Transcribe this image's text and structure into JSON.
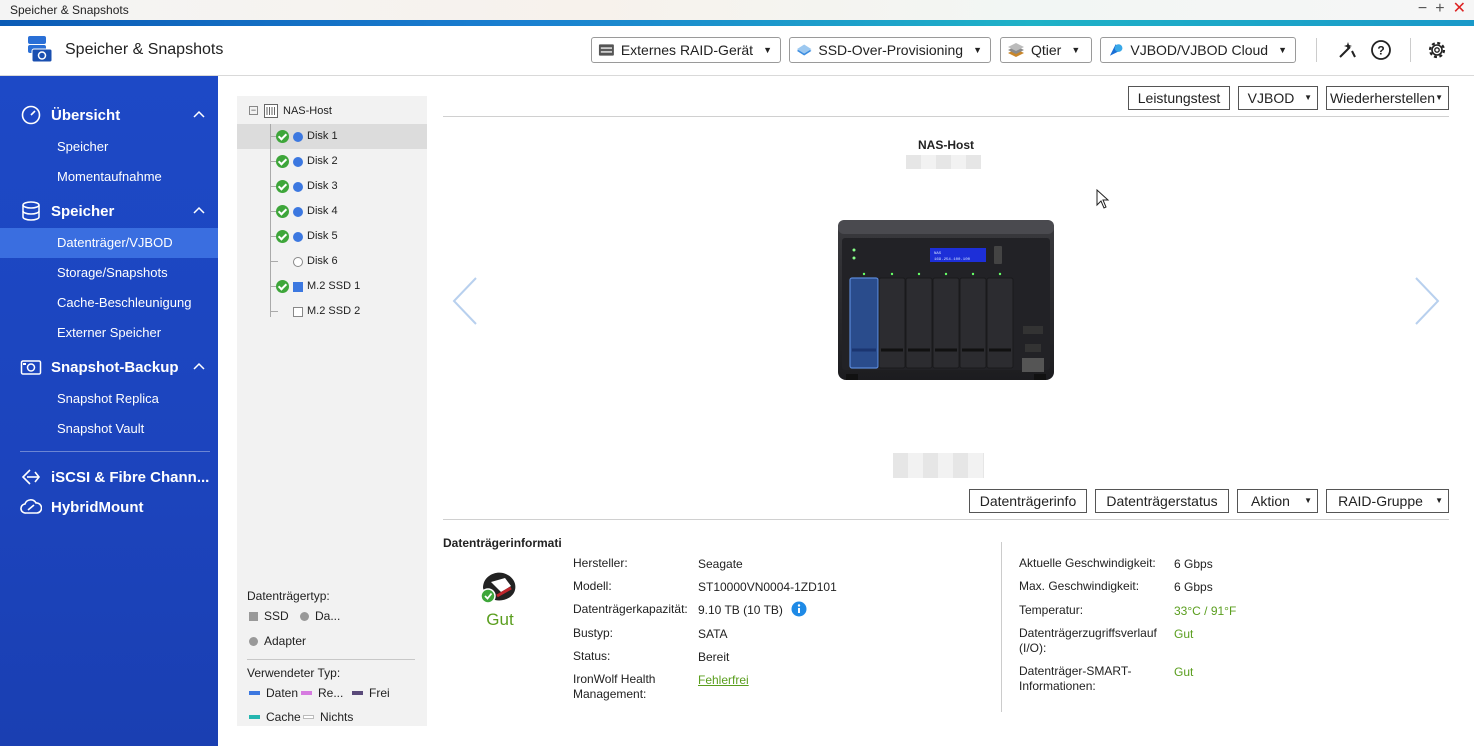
{
  "window": {
    "title": "Speicher & Snapshots"
  },
  "header": {
    "app_title": "Speicher & Snapshots",
    "buttons": [
      {
        "label": "Externes RAID-Gerät",
        "icon": "raid-device-icon"
      },
      {
        "label": "SSD-Over-Provisioning",
        "icon": "ssd-icon"
      },
      {
        "label": "Qtier",
        "icon": "qtier-icon"
      },
      {
        "label": "VJBOD/VJBOD Cloud",
        "icon": "vjbod-cloud-icon"
      }
    ],
    "icons": [
      "tools-icon",
      "help-icon",
      "settings-icon"
    ]
  },
  "sidebar": {
    "groups": [
      {
        "label": "Übersicht",
        "icon": "dashboard-icon",
        "items": [
          "Speicher",
          "Momentaufnahme"
        ]
      },
      {
        "label": "Speicher",
        "icon": "storage-icon",
        "items": [
          "Datenträger/VJBOD",
          "Storage/Snapshots",
          "Cache-Beschleunigung",
          "Externer Speicher"
        ]
      },
      {
        "label": "Snapshot-Backup",
        "icon": "snapshot-backup-icon",
        "items": [
          "Snapshot Replica",
          "Snapshot Vault"
        ]
      }
    ],
    "extra": [
      {
        "label": "iSCSI & Fibre Chann...",
        "icon": "iscsi-icon"
      },
      {
        "label": "HybridMount",
        "icon": "cloud-icon"
      }
    ]
  },
  "tree": {
    "root": "NAS-Host",
    "items": [
      {
        "label": "Disk 1",
        "ok": true,
        "kind": "disk"
      },
      {
        "label": "Disk 2",
        "ok": true,
        "kind": "disk"
      },
      {
        "label": "Disk 3",
        "ok": true,
        "kind": "disk"
      },
      {
        "label": "Disk 4",
        "ok": true,
        "kind": "disk"
      },
      {
        "label": "Disk 5",
        "ok": true,
        "kind": "disk"
      },
      {
        "label": "Disk 6",
        "ok": false,
        "kind": "disk-empty"
      },
      {
        "label": "M.2 SSD 1",
        "ok": true,
        "kind": "ssd"
      },
      {
        "label": "M.2 SSD 2",
        "ok": false,
        "kind": "ssd-empty"
      }
    ]
  },
  "legend": {
    "type_title": "Datenträgertyp:",
    "types": [
      "SSD",
      "Da...",
      "Adapter"
    ],
    "used_title": "Verwendeter Typ:",
    "used": [
      {
        "label": "Daten",
        "color": "#3c78e0"
      },
      {
        "label": "Re...",
        "color": "#d67be0"
      },
      {
        "label": "Frei",
        "color": "#5a4a7a"
      },
      {
        "label": "Cache",
        "color": "#25b6b0"
      },
      {
        "label": "Nichts",
        "color": "#ffffff"
      }
    ]
  },
  "toolbar_top": {
    "benchmark": "Leistungstest",
    "vjbod": "VJBOD",
    "restore": "Wiederherstellen"
  },
  "device": {
    "title": "NAS-Host",
    "lcd": "NAS 169.254.100.100"
  },
  "toolbar_bottom": {
    "info": "Datenträgerinfo",
    "status": "Datenträgerstatus",
    "action": "Aktion",
    "raid": "RAID-Gruppe"
  },
  "info": {
    "heading": "Datenträgerinformati",
    "health": "Gut",
    "left": [
      {
        "label": "Hersteller:",
        "value": "Seagate"
      },
      {
        "label": "Modell:",
        "value": "ST10000VN0004-1ZD101"
      },
      {
        "label": "Datenträgerkapazität:",
        "value": "9.10 TB (10 TB)"
      },
      {
        "label": "Bustyp:",
        "value": "SATA"
      },
      {
        "label": "Status:",
        "value": "Bereit"
      },
      {
        "label": "IronWolf Health Management:",
        "value": "Fehlerfrei"
      }
    ],
    "right": [
      {
        "label": "Aktuelle Geschwindigkeit:",
        "value": "6 Gbps"
      },
      {
        "label": "Max. Geschwindigkeit:",
        "value": "6 Gbps"
      },
      {
        "label": "Temperatur:",
        "value": "33°C / 91°F"
      },
      {
        "label": "Datenträgerzugriffsverlauf (I/O):",
        "value": "Gut"
      },
      {
        "label": "Datenträger-SMART-Informationen:",
        "value": "Gut"
      }
    ]
  },
  "colors": {
    "sidebar": "#1d49c6",
    "active": "#3a6ee0",
    "ok_green": "#3ea63a",
    "good_text": "#5a9e1e"
  }
}
